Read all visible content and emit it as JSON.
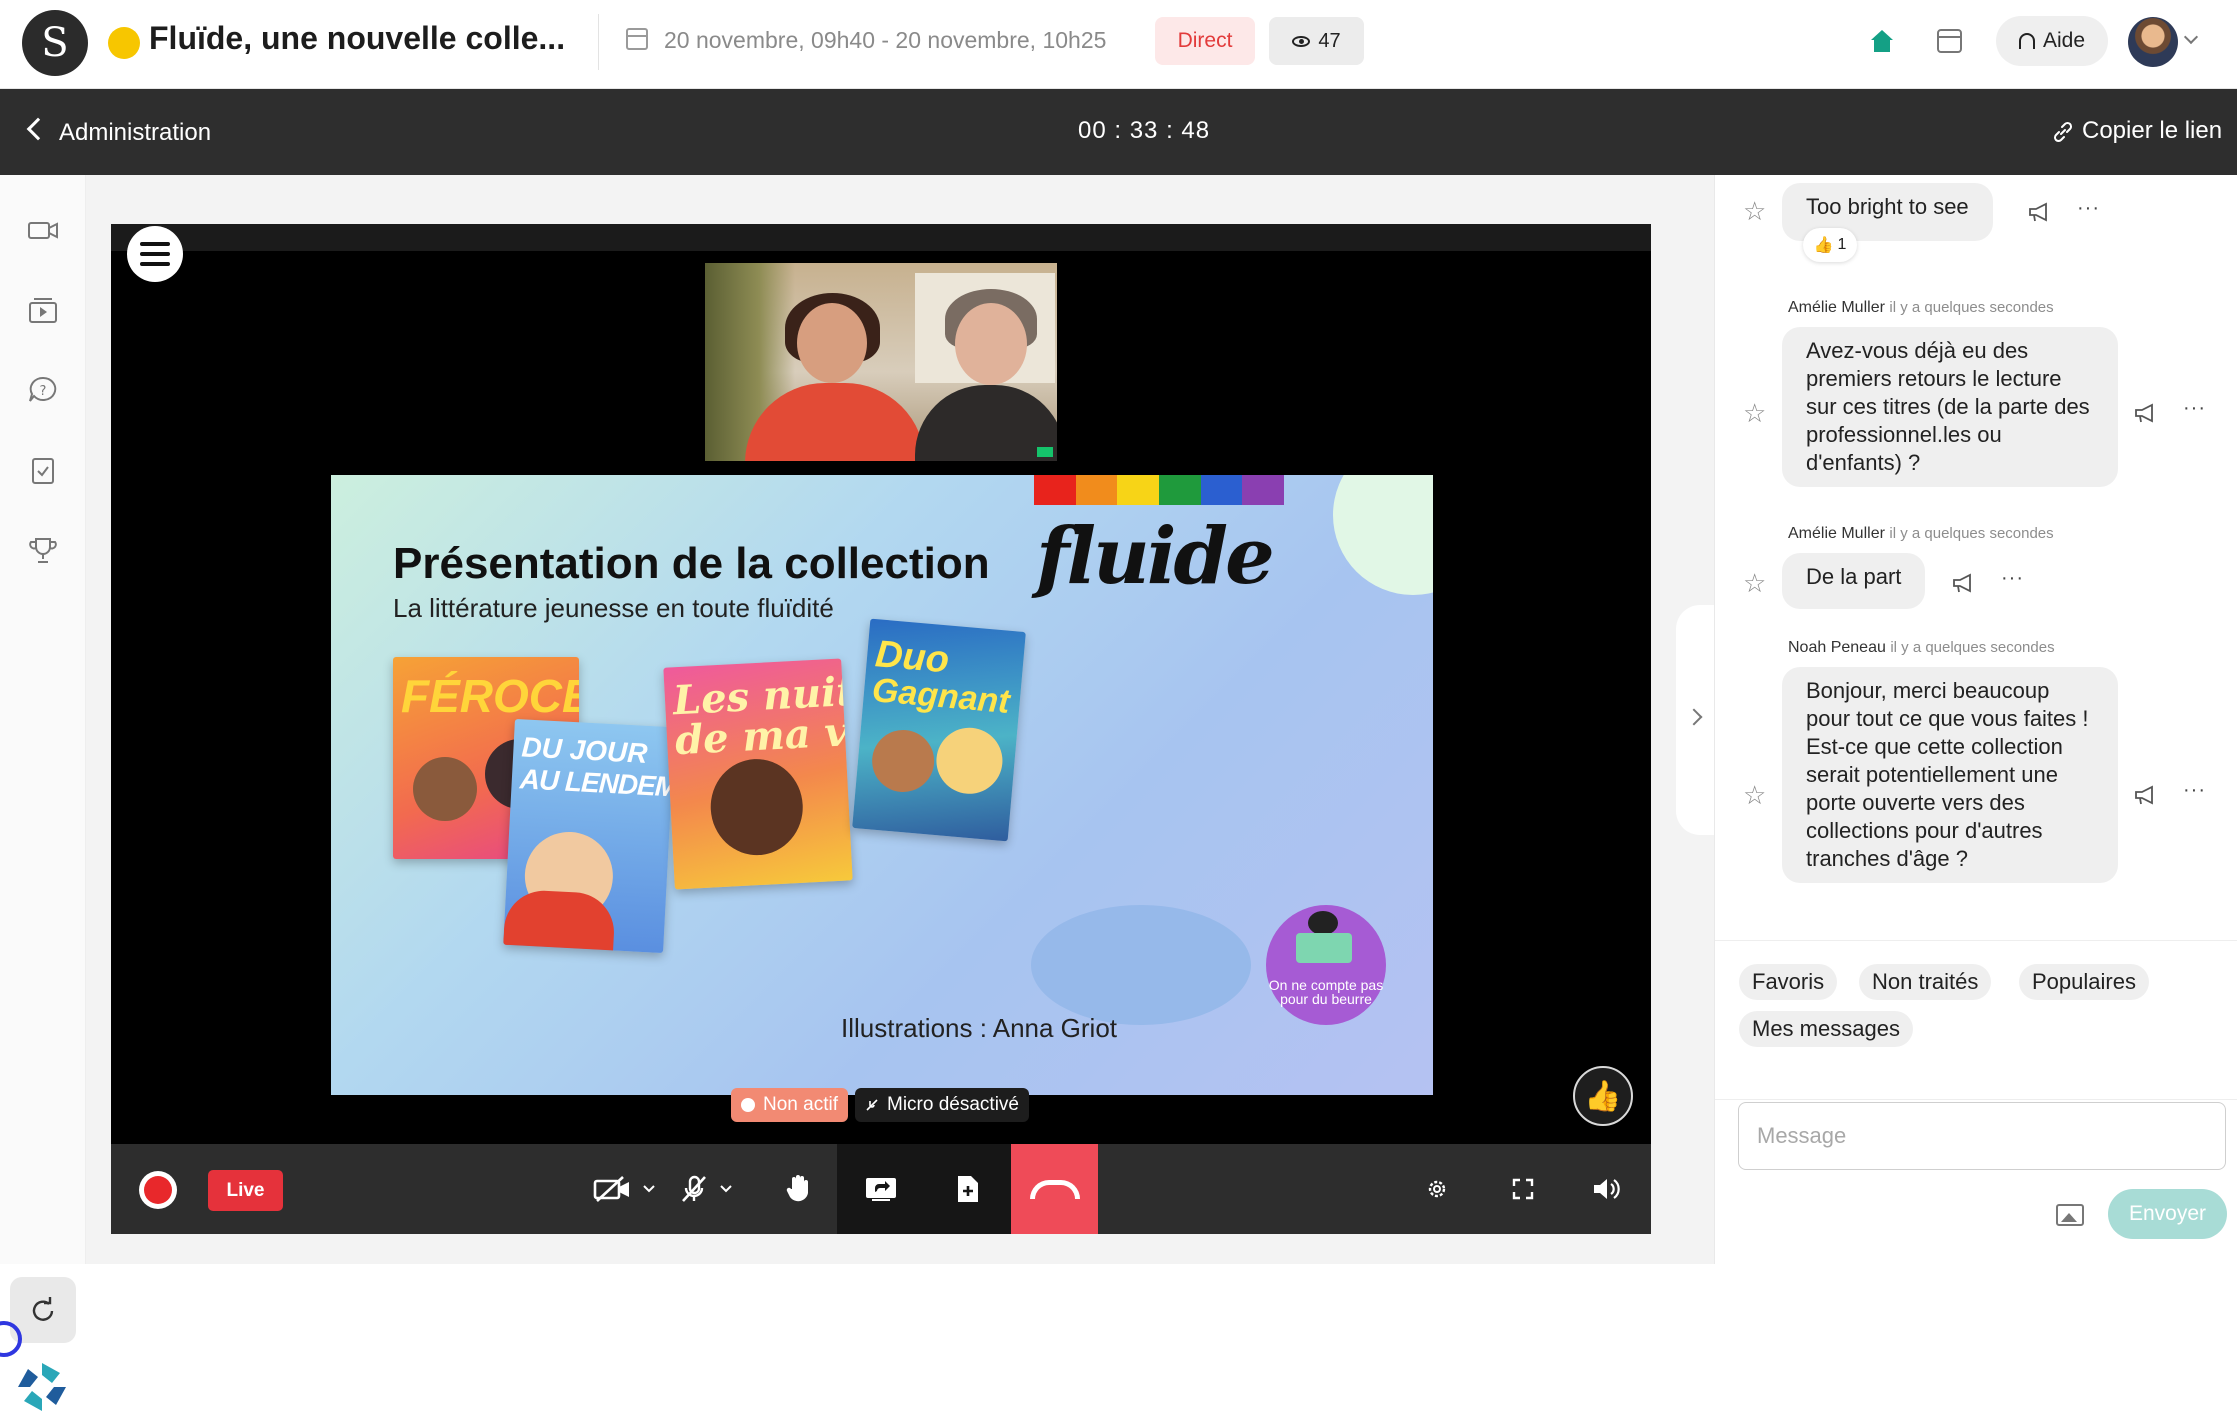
{
  "header": {
    "logo_letter": "S",
    "event_title": "Fluïde, une nouvelle colle...",
    "date_range": "20 novembre, 09h40 - 20 novembre, 10h25",
    "status_badge": "Direct",
    "viewer_count": "47",
    "help_label": "Aide"
  },
  "subbar": {
    "back_label": "Administration",
    "timer": "00 : 33 : 48",
    "copy_link_label": "Copier le lien"
  },
  "slide": {
    "title": "Présentation de la collection",
    "subtitle": "La littérature jeunesse en toute fluïdité",
    "brand": "fluide",
    "books": [
      {
        "title_line1": "FÉROCE",
        "title_line2": ""
      },
      {
        "title_line1": "DU JOUR",
        "title_line2": "AU LENDEMAIN"
      },
      {
        "title_line1": "Les nuits",
        "title_line2": "de ma vie"
      },
      {
        "title_line1": "Duo",
        "title_line2": "Gagnant"
      }
    ],
    "credit": "Illustrations : Anna Griot",
    "sticker_text": "On ne compte pas pour du beurre",
    "rainbow_colors": [
      "#e8231c",
      "#f18c1c",
      "#f7d417",
      "#1f9a3c",
      "#2b5fd0",
      "#8a3fb1"
    ]
  },
  "stage_status": {
    "inactive_label": "Non actif",
    "mic_label": "Micro désactivé",
    "thumb_reaction": "👍"
  },
  "controls": {
    "live_label": "Live"
  },
  "chat": {
    "messages": [
      {
        "author": "",
        "time": "",
        "text": "Too bright to see",
        "reaction_emoji": "👍",
        "reaction_count": "1"
      },
      {
        "author": "Amélie Muller",
        "time": "il y a quelques secondes",
        "text": "Avez-vous déjà eu des premiers retours le lecture sur ces titres (de la parte des professionnel.les ou d'enfants) ?"
      },
      {
        "author": "Amélie Muller",
        "time": "il y a quelques secondes",
        "text": "De la part"
      },
      {
        "author": "Noah Peneau",
        "time": "il y a quelques secondes",
        "text": "Bonjour, merci beaucoup pour tout ce que vous faites ! Est-ce que cette collection serait potentiellement une porte ouverte vers des collections pour d'autres tranches d'âge ?"
      }
    ],
    "filters": [
      "Favoris",
      "Non traités",
      "Populaires",
      "Mes messages"
    ],
    "input_placeholder": "Message",
    "send_label": "Envoyer",
    "more_glyph": "···",
    "star_glyph": "☆"
  },
  "colors": {
    "accent_red": "#e5323b",
    "accent_teal": "#a8dcd6",
    "title_dot": "#f7c600",
    "home_icon": "#14a085"
  }
}
